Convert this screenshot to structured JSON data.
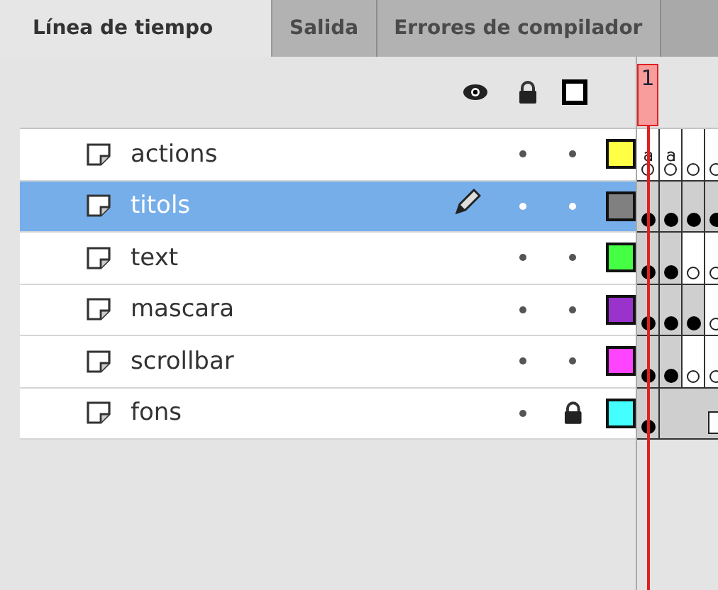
{
  "tabs": [
    {
      "label": "Línea de tiempo",
      "selected": true
    },
    {
      "label": "Salida",
      "selected": false
    },
    {
      "label": "Errores de compilador",
      "selected": false
    }
  ],
  "timeline": {
    "playhead": "1"
  },
  "layers": [
    {
      "name": "actions",
      "selected": false,
      "locked": false,
      "color": "#ffff44",
      "frames": [
        {
          "kind": "action"
        },
        {
          "kind": "action"
        },
        {
          "kind": "blank"
        },
        {
          "kind": "blank"
        }
      ]
    },
    {
      "name": "titols",
      "selected": true,
      "locked": false,
      "color": "#808080",
      "frames": [
        {
          "kind": "key"
        },
        {
          "kind": "key"
        },
        {
          "kind": "key"
        },
        {
          "kind": "key"
        }
      ]
    },
    {
      "name": "text",
      "selected": false,
      "locked": false,
      "color": "#44ff44",
      "frames": [
        {
          "kind": "key"
        },
        {
          "kind": "key"
        },
        {
          "kind": "blank"
        },
        {
          "kind": "blank"
        }
      ]
    },
    {
      "name": "mascara",
      "selected": false,
      "locked": false,
      "color": "#9933cc",
      "frames": [
        {
          "kind": "key"
        },
        {
          "kind": "key"
        },
        {
          "kind": "key"
        },
        {
          "kind": "blank"
        }
      ]
    },
    {
      "name": "scrollbar",
      "selected": false,
      "locked": false,
      "color": "#ff44ff",
      "frames": [
        {
          "kind": "key"
        },
        {
          "kind": "key"
        },
        {
          "kind": "blank"
        },
        {
          "kind": "blank"
        }
      ]
    },
    {
      "name": "fons",
      "selected": false,
      "locked": true,
      "color": "#44ffff",
      "frames": [
        {
          "kind": "key"
        },
        {
          "kind": "span"
        },
        {
          "kind": "span"
        },
        {
          "kind": "end"
        }
      ]
    }
  ]
}
